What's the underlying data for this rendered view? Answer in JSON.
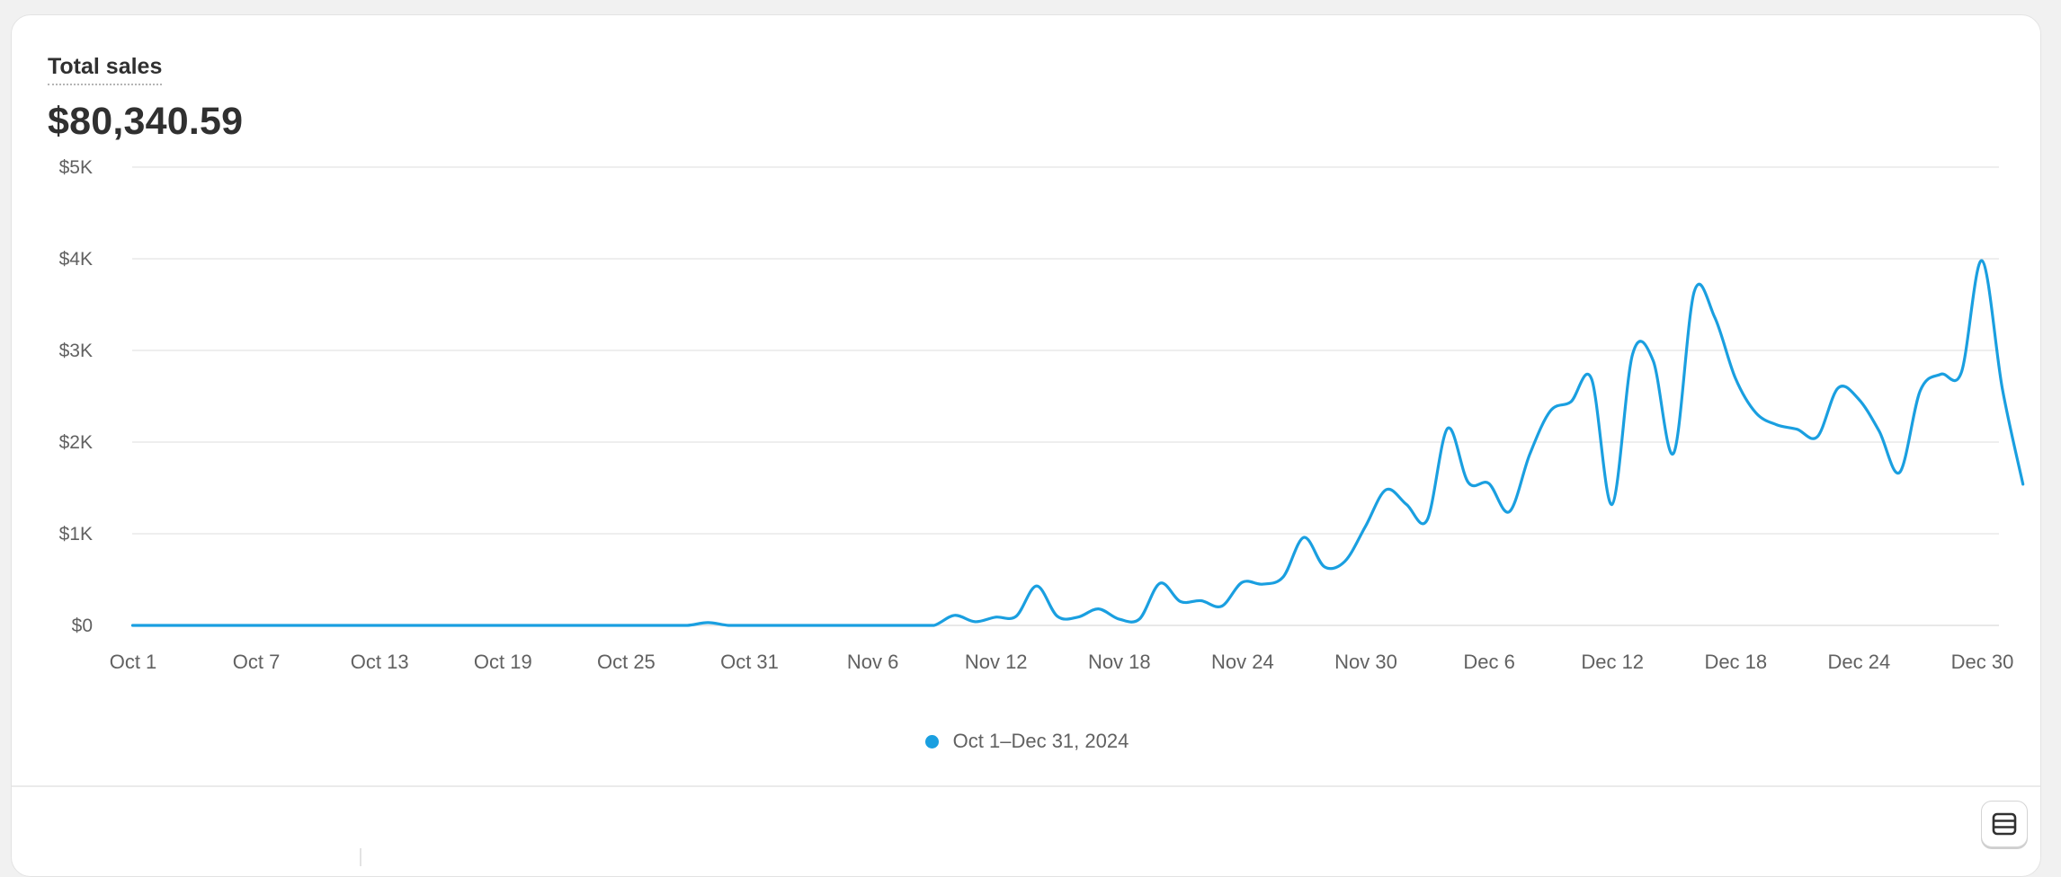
{
  "metric": {
    "label": "Total sales",
    "value": "$80,340.59"
  },
  "colors": {
    "series": "#1a9fe0",
    "grid": "#e8e8e8",
    "text": "#303030",
    "muted": "#616161"
  },
  "icons": {
    "view_toggle": "table-view-icon"
  },
  "chart_data": {
    "type": "line",
    "y_ticks": [
      "$0",
      "$1K",
      "$2K",
      "$3K",
      "$4K",
      "$5K"
    ],
    "x_ticks": [
      "Oct 1",
      "Oct 7",
      "Oct 13",
      "Oct 19",
      "Oct 25",
      "Oct 31",
      "Nov 6",
      "Nov 12",
      "Nov 18",
      "Nov 24",
      "Nov 30",
      "Dec 6",
      "Dec 12",
      "Dec 18",
      "Dec 24",
      "Dec 30"
    ],
    "ylim": [
      0,
      5000
    ],
    "grid": true,
    "legend_position": "bottom-center",
    "series": [
      {
        "name": "Oct 1–Dec 31, 2024",
        "color": "#1a9fe0",
        "values": [
          0,
          0,
          0,
          0,
          0,
          0,
          0,
          0,
          0,
          0,
          0,
          0,
          0,
          0,
          0,
          0,
          0,
          0,
          0,
          0,
          0,
          0,
          0,
          0,
          0,
          0,
          0,
          0,
          30,
          0,
          0,
          0,
          0,
          0,
          0,
          0,
          0,
          0,
          0,
          0,
          110,
          40,
          90,
          100,
          430,
          100,
          90,
          180,
          70,
          70,
          460,
          260,
          270,
          210,
          470,
          450,
          530,
          960,
          640,
          700,
          1080,
          1480,
          1320,
          1150,
          2150,
          1560,
          1550,
          1240,
          1870,
          2340,
          2440,
          2690,
          1320,
          2960,
          2890,
          1880,
          3640,
          3360,
          2700,
          2320,
          2190,
          2140,
          2060,
          2590,
          2470,
          2120,
          1670,
          2560,
          2740,
          2760,
          3980,
          2580,
          1540
        ]
      }
    ]
  },
  "legend": {
    "label": "Oct 1–Dec 31, 2024"
  }
}
